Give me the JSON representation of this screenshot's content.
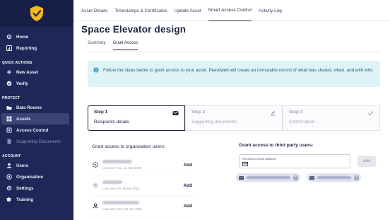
{
  "sidebar": {
    "items_top": [
      {
        "label": "Home",
        "icon": "gear-icon"
      },
      {
        "label": "Reporting",
        "icon": "bar-chart-icon"
      }
    ],
    "section_quick": "QUICK ACTIONS",
    "quick_items": [
      {
        "label": "New Asset",
        "icon": "plus-icon"
      },
      {
        "label": "Verify",
        "icon": "check-circle-icon"
      }
    ],
    "section_protect": "PROTECT",
    "protect_items": [
      {
        "label": "Data Rooms",
        "icon": "folder-icon"
      },
      {
        "label": "Assets",
        "icon": "grid-icon"
      },
      {
        "label": "Access Control",
        "icon": "lock-icon"
      },
      {
        "label": "Supporting Documents",
        "icon": "document-icon"
      }
    ],
    "section_account": "ACCOUNT",
    "account_items": [
      {
        "label": "Users",
        "icon": "user-icon"
      },
      {
        "label": "Organisation",
        "icon": "organisation-icon"
      },
      {
        "label": "Settings",
        "icon": "gear-icon"
      },
      {
        "label": "Training",
        "icon": "graduation-cap-icon"
      }
    ]
  },
  "top_tabs": [
    "Asset Details",
    "Timestamps & Certificates",
    "Update Asset",
    "Smart Access Control",
    "Activity Log"
  ],
  "page_title": "Space Elevator design",
  "sub_tabs": [
    "Summary",
    "Grant Access"
  ],
  "info_text": "Follow the steps below to grant access to your asset. Peerdweb will create an immutable record of what was shared, when, and with who.",
  "steps": [
    {
      "num": "Step 1",
      "label": "Recipients details",
      "icon": "envelope-icon"
    },
    {
      "num": "Step 2",
      "label": "Supporting documents",
      "icon": "pencil-icon"
    },
    {
      "num": "Step 3",
      "label": "Confirmation",
      "icon": "check-icon"
    }
  ],
  "org_section_title": "Grant access to organisation users:",
  "orgs": [
    {
      "sub": "Last seen: Tue, 11 Mar 2025",
      "add": "Add",
      "icon": "organisation-icon"
    },
    {
      "sub": "Last seen: Fri, 28 Mar 2025",
      "add": "Add",
      "icon": "user-icon"
    },
    {
      "sub": "Last seen: Wed, 01 Jan 2025",
      "add": "Add",
      "icon": "user-icon"
    }
  ],
  "third_section_title": "Grant access to third party users:",
  "email_label": "Recipient email address",
  "email_value": "",
  "email_add": "Add",
  "colors": {
    "sidebar": "#1e2757",
    "accent_gold": "#f2b91f",
    "info_bg": "#def3f8"
  }
}
